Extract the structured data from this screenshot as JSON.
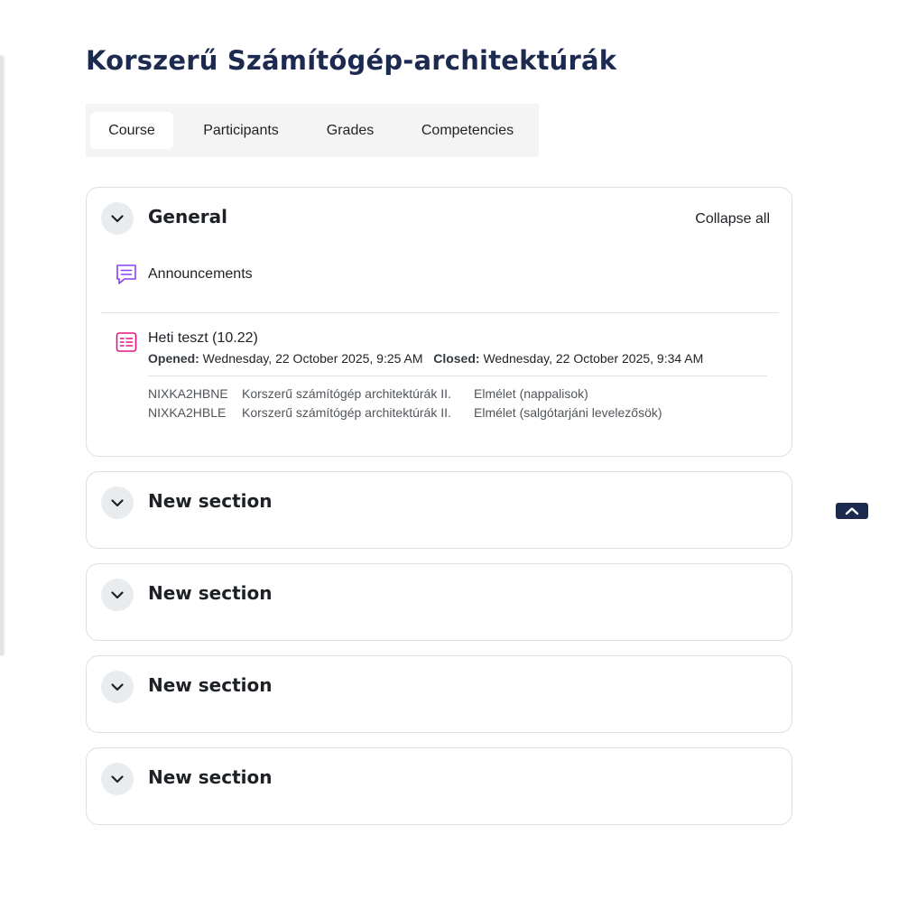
{
  "course": {
    "title": "Korszerű Számítógép-architektúrák"
  },
  "tabs": [
    {
      "label": "Course",
      "active": true
    },
    {
      "label": "Participants",
      "active": false
    },
    {
      "label": "Grades",
      "active": false
    },
    {
      "label": "Competencies",
      "active": false
    }
  ],
  "general": {
    "title": "General",
    "collapse_all": "Collapse all",
    "announcements": {
      "label": "Announcements",
      "icon": "forum-icon"
    },
    "quiz": {
      "label": "Heti teszt (10.22)",
      "icon": "quiz-icon",
      "opened_label": "Opened:",
      "opened_value": "Wednesday, 22 October 2025, 9:25 AM",
      "closed_label": "Closed:",
      "closed_value": "Wednesday, 22 October 2025, 9:34 AM",
      "groups": [
        {
          "code": "NIXKA2HBNE",
          "course": "Korszerű számítógép architektúrák II.",
          "type": "Elmélet (nappalisok)"
        },
        {
          "code": "NIXKA2HBLE",
          "course": "Korszerű számítógép architektúrák II.",
          "type": "Elmélet (salgótarjáni levelezősök)"
        }
      ]
    }
  },
  "sections": [
    {
      "title": "New section"
    },
    {
      "title": "New section"
    },
    {
      "title": "New section"
    },
    {
      "title": "New section"
    }
  ],
  "colors": {
    "title": "#1d2a4f",
    "forum_icon": "#8a3ffc",
    "quiz_icon": "#e2177d",
    "toggle_bg": "#e9ecef"
  }
}
